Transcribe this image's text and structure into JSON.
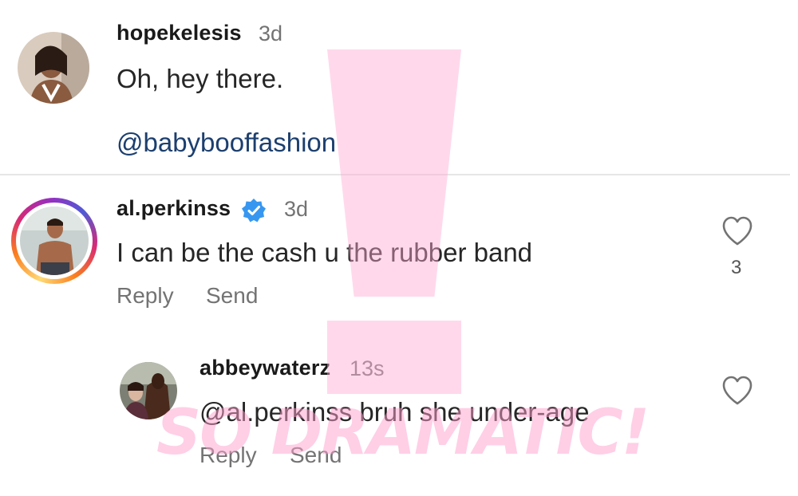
{
  "comments": [
    {
      "username": "hopekelesis",
      "time": "3d",
      "text": "Oh, hey there.",
      "mention": "@babybooffashion"
    },
    {
      "username": "al.perkinss",
      "verified": true,
      "time": "3d",
      "text": "I can be the cash u the rubber band",
      "actions": {
        "reply": "Reply",
        "send": "Send"
      },
      "likes": "3"
    },
    {
      "username": "abbeywaterz",
      "time": "13s",
      "text": "@al.perkinss bruh she under-age",
      "actions": {
        "reply": "Reply",
        "send": "Send"
      }
    }
  ],
  "watermark": {
    "text": "SO DRAMATIC!",
    "color": "#ffa0cd"
  },
  "colors": {
    "verified": "#3797f0",
    "mention": "#1c3f6e",
    "muted": "#737373"
  },
  "icons": {
    "verified": "verified-badge-icon",
    "like": "heart-outline-icon"
  }
}
